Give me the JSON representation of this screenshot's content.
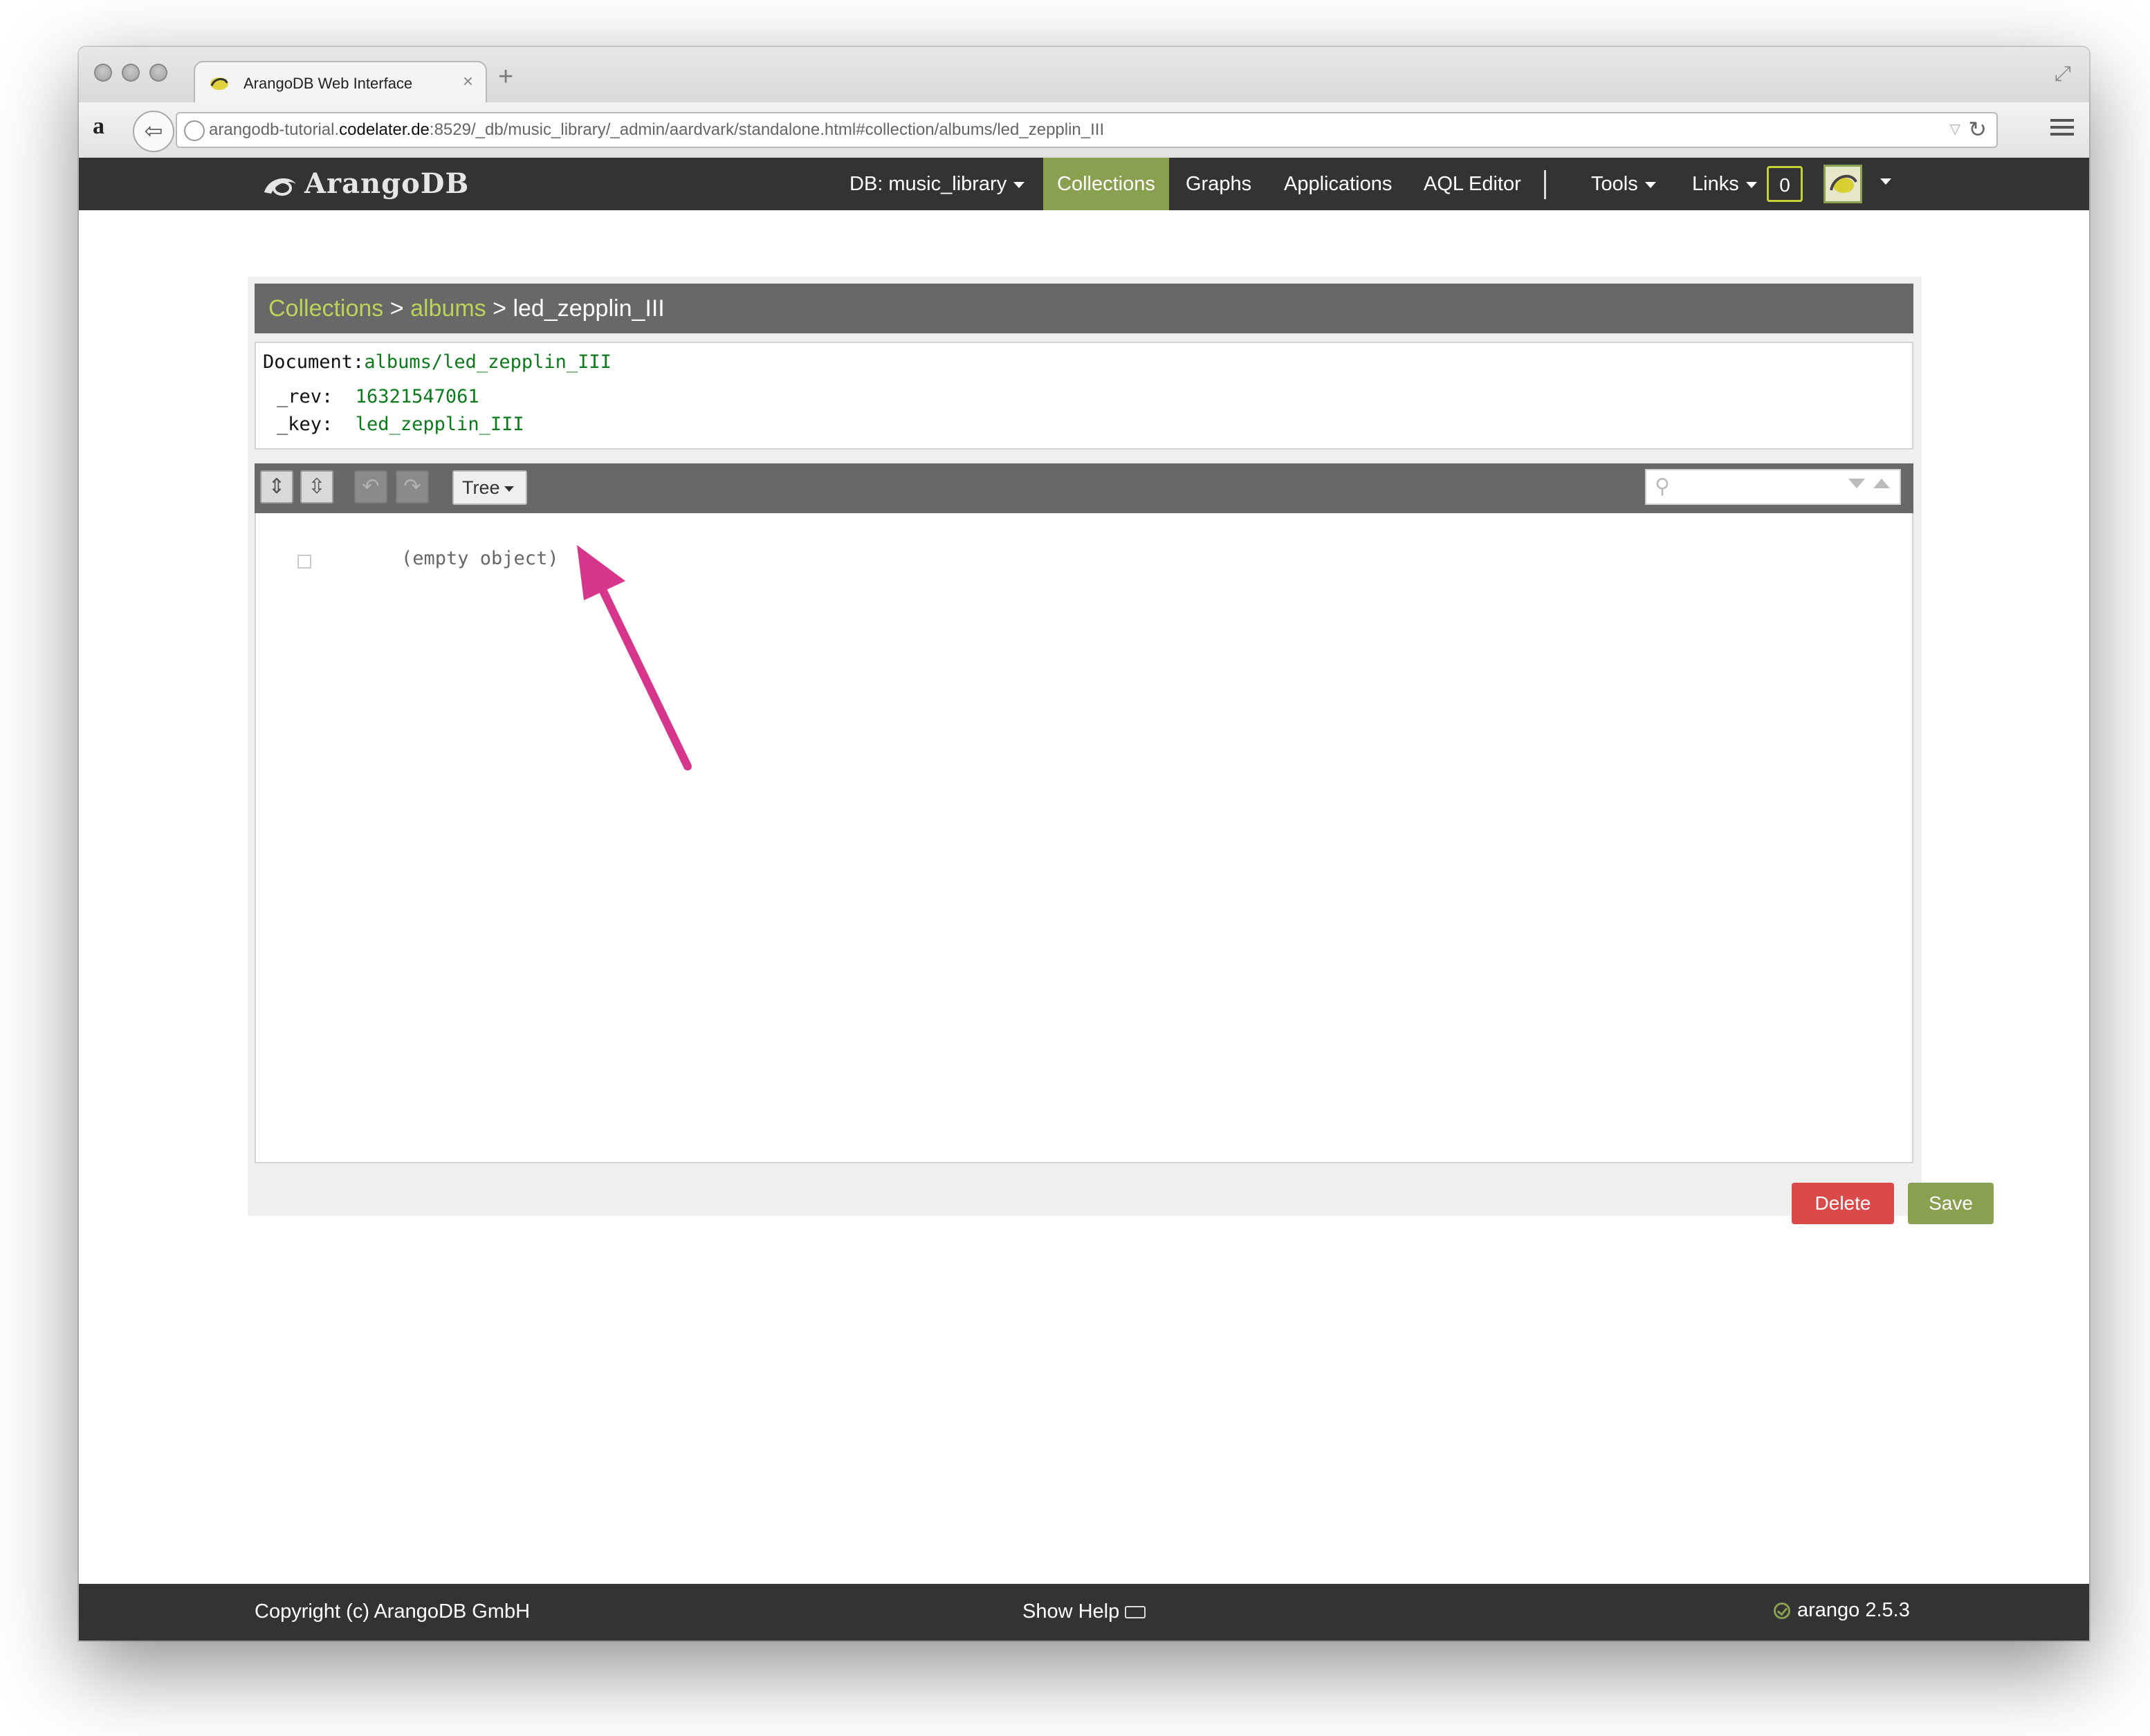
{
  "browser": {
    "tab_title": "ArangoDB Web Interface",
    "new_tab_label": "+",
    "tab_close_label": "×",
    "url_prefix": "arangodb-tutorial.",
    "url_host": "codelater.de",
    "url_suffix": ":8529/_db/music_library/_admin/aardvark/standalone.html#collection/albums/led_zepplin_III",
    "amazon_label": "a",
    "back_label": "⇦",
    "reload_label": "↻",
    "dropdown_label": "▽",
    "fullscreen_label": "⤢"
  },
  "nav": {
    "logo_text": "ArangoDB",
    "db_label": "DB: music_library",
    "collections": "Collections",
    "graphs": "Graphs",
    "applications": "Applications",
    "aql_editor": "AQL Editor",
    "tools": "Tools",
    "links": "Links",
    "notifications_count": "0"
  },
  "breadcrumb": {
    "collections": "Collections",
    "separator": ">",
    "collection": "albums",
    "document": "led_zepplin_III"
  },
  "document": {
    "label": "Document:",
    "id": "albums/led_zepplin_III",
    "rev_label": "_rev:",
    "rev": "16321547061",
    "key_label": "_key:",
    "key": "led_zepplin_III"
  },
  "editor": {
    "expand_all": "⇕",
    "collapse_all": "⇳",
    "undo": "↶",
    "redo": "↷",
    "mode": "Tree",
    "search_icon": "⚲",
    "content": "(empty object)"
  },
  "actions": {
    "delete": "Delete",
    "save": "Save"
  },
  "footer": {
    "copyright": "Copyright (c) ArangoDB GmbH",
    "help": "Show Help",
    "version": "arango 2.5.3"
  },
  "colors": {
    "accent": "#8aa051",
    "link": "#b9d458",
    "danger": "#da4a4a",
    "annotation_arrow": "#d6368b"
  }
}
